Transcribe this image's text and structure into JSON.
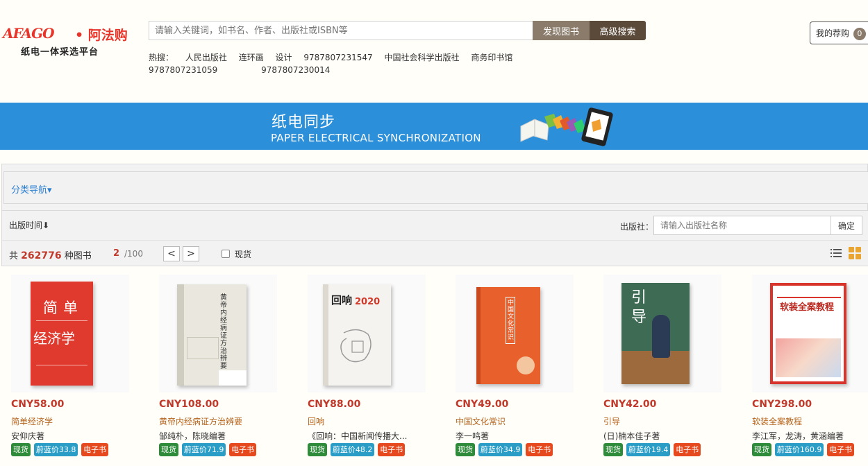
{
  "header": {
    "logo_mark": "AFAGO",
    "logo_cn": "• 阿法购",
    "logo_sub": "纸电一体采选平台",
    "search_placeholder": "请输入关键词，如书名、作者、出版社或ISBN等",
    "find_button": "发现图书",
    "advanced_button": "高级搜索",
    "hot_label": "热搜：",
    "hot_terms": [
      "人民出版社",
      "连环画",
      "设计",
      "9787807231547",
      "中国社会科学出版社",
      "商务印书馆",
      "9787807231059",
      "9787807230014"
    ],
    "cart_label": "我的荐购",
    "cart_count": "0"
  },
  "banner": {
    "title": "纸电同步",
    "subtitle": "PAPER ELECTRICAL SYNCHRONIZATION"
  },
  "category": {
    "label": "分类导航▾"
  },
  "filter": {
    "sort_label": "出版时间⬇",
    "publisher_label": "出版社：",
    "publisher_placeholder": "请输入出版社名称",
    "confirm_button": "确定"
  },
  "stats": {
    "prefix": "共",
    "total": "262776",
    "suffix": "种图书",
    "current_page": "2",
    "total_pages": "/100",
    "prev": "<",
    "next": ">",
    "instock_label": "现货"
  },
  "products": [
    {
      "price": "CNY58.00",
      "title": "简单经济学",
      "author": "安仰庆著",
      "tag_stock": "现货",
      "tag_price": "蔚蓝价33.8",
      "tag_ebook": "电子书",
      "cover_text": "简 单\n经济学",
      "cover_color": "#e03a2f"
    },
    {
      "price": "CNY108.00",
      "title": "黄帝内经病证方治辨要",
      "author": "邹纯朴，陈晓编著",
      "tag_stock": "现货",
      "tag_price": "蔚蓝价71.9",
      "tag_ebook": "电子书",
      "cover_text": "黄帝内经病证方治辨要",
      "cover_color": "#e8e6dc"
    },
    {
      "price": "CNY88.00",
      "title": "回响",
      "author": "《回响：中国新闻传播大...",
      "tag_stock": "现货",
      "tag_price": "蔚蓝价48.2",
      "tag_ebook": "电子书",
      "cover_text": "回响 2020",
      "cover_color": "#f4f2ee"
    },
    {
      "price": "CNY49.00",
      "title": "中国文化常识",
      "author": "李一鸣著",
      "tag_stock": "现货",
      "tag_price": "蔚蓝价34.9",
      "tag_ebook": "电子书",
      "cover_text": "中国文化常识",
      "cover_color": "#e8602c"
    },
    {
      "price": "CNY42.00",
      "title": "引导",
      "author": "(日)楠本佳子著",
      "tag_stock": "现货",
      "tag_price": "蔚蓝价19.4",
      "tag_ebook": "电子书",
      "cover_text": "引导",
      "cover_color": "#3e6b54"
    },
    {
      "price": "CNY298.00",
      "title": "软装全案教程",
      "author": "李江军，龙涛，黄涵编著",
      "tag_stock": "现货",
      "tag_price": "蔚蓝价160.9",
      "tag_ebook": "电子书",
      "cover_text": "软装全案教程",
      "cover_color": "#d9342b"
    }
  ]
}
